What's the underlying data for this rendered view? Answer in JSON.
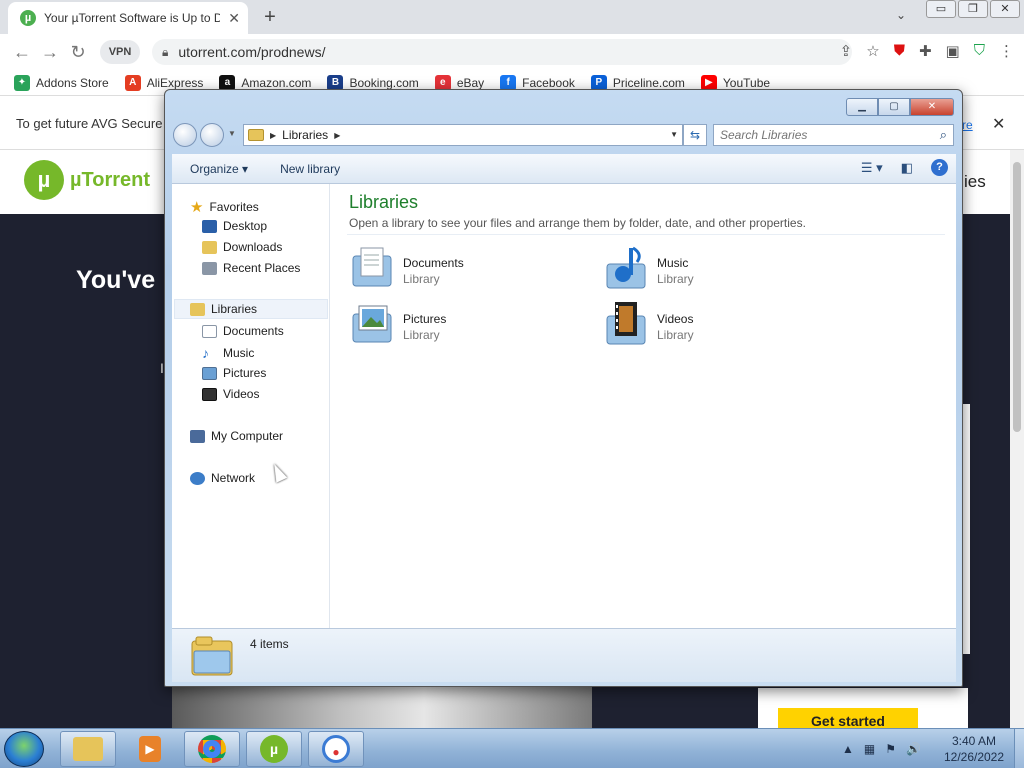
{
  "browser": {
    "tab_title": "Your µTorrent Software is Up to D",
    "tab_favicon": "µ",
    "tab_close": "✕",
    "new_tab": "+",
    "tab_search": "⌄",
    "window_buttons": [
      "▭",
      "❐",
      "✕"
    ],
    "vpn_label": "VPN",
    "url": "utorrent.com/prodnews/",
    "bookmarks": [
      {
        "label": "Addons Store",
        "icon": "addons-store-icon",
        "glyph": "✦",
        "color": "#2aa35a"
      },
      {
        "label": "AliExpress",
        "icon": "aliexpress-icon",
        "glyph": "A",
        "color": "#e43d22"
      },
      {
        "label": "Amazon.com",
        "icon": "amazon-icon",
        "glyph": "a",
        "color": "#111111"
      },
      {
        "label": "Booking.com",
        "icon": "booking-icon",
        "glyph": "B",
        "color": "#1b3f8b"
      },
      {
        "label": "eBay",
        "icon": "ebay-icon",
        "glyph": "e",
        "color": "#e53238"
      },
      {
        "label": "Facebook",
        "icon": "facebook-icon",
        "glyph": "f",
        "color": "#1877f2"
      },
      {
        "label": "Priceline.com",
        "icon": "priceline-icon",
        "glyph": "P",
        "color": "#0a60d8"
      },
      {
        "label": "YouTube",
        "icon": "youtube-icon",
        "glyph": "▶",
        "color": "#ff0000"
      }
    ],
    "avg_message": "To get future AVG Secure",
    "avg_link": "re",
    "avg_close": "✕"
  },
  "site": {
    "logo_mark": "µ",
    "logo_word": "µTorrent",
    "nav_fragment": "ies",
    "hero_heading": "You've",
    "hero_stub": "I",
    "cta_label": "Get started"
  },
  "explorer": {
    "caption": {
      "min": "▁",
      "max": "▢",
      "close": "✕"
    },
    "breadcrumb": "Libraries",
    "search_placeholder": "Search Libraries",
    "organize_label": "Organize ▾",
    "new_library_label": "New library",
    "view_icon": "☰ ▾",
    "pane_icon": "◧",
    "help_label": "?",
    "nav": {
      "favorites": "Favorites",
      "desktop": "Desktop",
      "downloads": "Downloads",
      "recent_places": "Recent Places",
      "libraries": "Libraries",
      "documents": "Documents",
      "music": "Music",
      "pictures": "Pictures",
      "videos": "Videos",
      "my_computer": "My Computer",
      "network": "Network"
    },
    "content_title": "Libraries",
    "content_desc": "Open a library to see your files and arrange them by folder, date, and other properties.",
    "libraries": [
      {
        "name": "Documents",
        "type": "Library"
      },
      {
        "name": "Music",
        "type": "Library"
      },
      {
        "name": "Pictures",
        "type": "Library"
      },
      {
        "name": "Videos",
        "type": "Library"
      }
    ],
    "status_count": "4 items"
  },
  "taskbar": {
    "clock_time": "3:40 AM",
    "clock_date": "12/26/2022",
    "tray_icons": [
      "▲",
      "▦",
      "⚑",
      "🔊"
    ]
  }
}
